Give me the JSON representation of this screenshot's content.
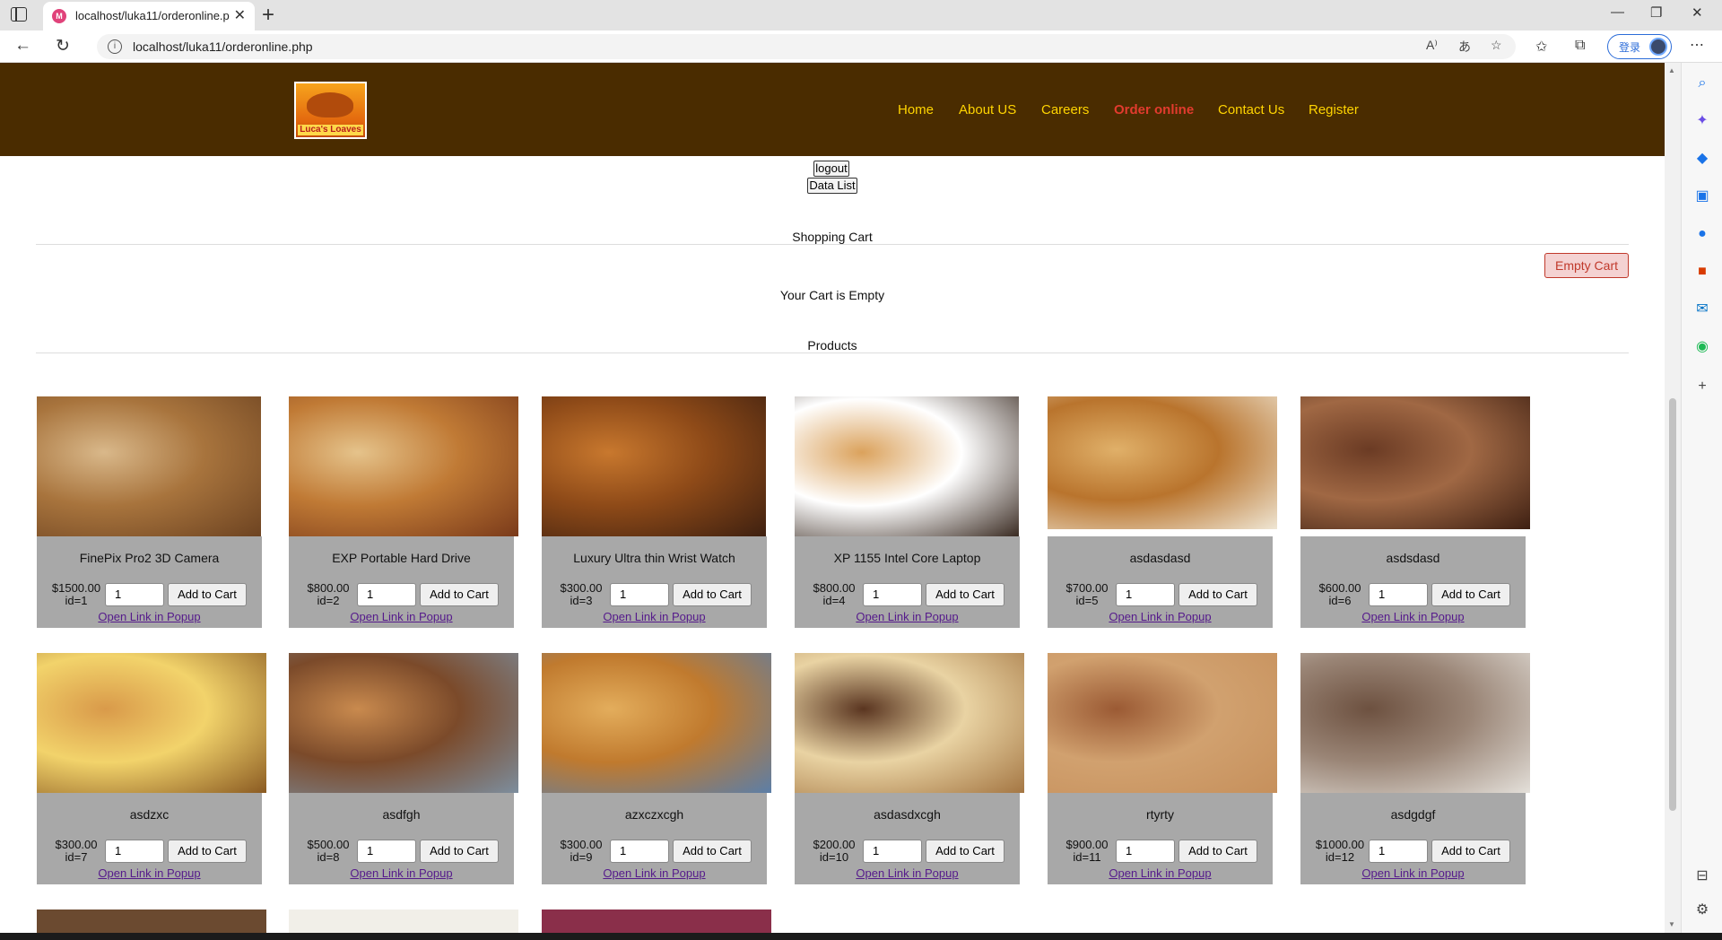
{
  "browser": {
    "tab_title": "localhost/luka11/orderonline.php",
    "url": "localhost/luka11/orderonline.php",
    "login_label": "登录"
  },
  "site": {
    "logo_text": "Luca's Loaves",
    "nav": [
      {
        "label": "Home"
      },
      {
        "label": "About US"
      },
      {
        "label": "Careers"
      },
      {
        "label": "Order online"
      },
      {
        "label": "Contact Us"
      },
      {
        "label": "Register"
      }
    ],
    "logout_label": "logout",
    "datalist_label": "Data List"
  },
  "cart": {
    "title": "Shopping Cart",
    "empty_button": "Empty Cart",
    "empty_message": "Your Cart is Empty"
  },
  "products": {
    "title": "Products",
    "add_label": "Add to Cart",
    "popup_label": "Open Link in Popup",
    "items": [
      {
        "name": "FinePix Pro2 3D Camera",
        "price": "$1500.00",
        "id": "id=1",
        "qty": "1"
      },
      {
        "name": "EXP Portable Hard Drive",
        "price": "$800.00",
        "id": "id=2",
        "qty": "1"
      },
      {
        "name": "Luxury Ultra thin Wrist Watch",
        "price": "$300.00",
        "id": "id=3",
        "qty": "1"
      },
      {
        "name": "XP 1155 Intel Core Laptop",
        "price": "$800.00",
        "id": "id=4",
        "qty": "1"
      },
      {
        "name": "asdasdasd",
        "price": "$700.00",
        "id": "id=5",
        "qty": "1"
      },
      {
        "name": "asdsdasd",
        "price": "$600.00",
        "id": "id=6",
        "qty": "1"
      },
      {
        "name": "asdzxc",
        "price": "$300.00",
        "id": "id=7",
        "qty": "1"
      },
      {
        "name": "asdfgh",
        "price": "$500.00",
        "id": "id=8",
        "qty": "1"
      },
      {
        "name": "azxczxcgh",
        "price": "$300.00",
        "id": "id=9",
        "qty": "1"
      },
      {
        "name": "asdasdxcgh",
        "price": "$200.00",
        "id": "id=10",
        "qty": "1"
      },
      {
        "name": "rtyrty",
        "price": "$900.00",
        "id": "id=11",
        "qty": "1"
      },
      {
        "name": "asdgdgf",
        "price": "$1000.00",
        "id": "id=12",
        "qty": "1"
      }
    ]
  }
}
